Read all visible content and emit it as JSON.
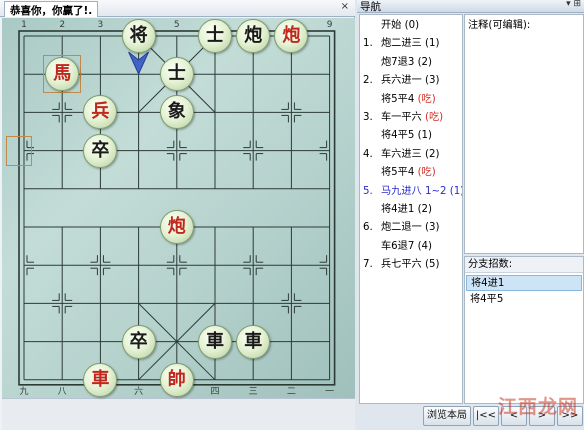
{
  "board_window": {
    "tab_title": "恭喜你，你赢了!.",
    "close_glyph": "×",
    "file_numbers_top": [
      "1",
      "2",
      "3",
      "4",
      "5",
      "6",
      "7",
      "8",
      "9"
    ],
    "file_numbers_bottom": [
      "九",
      "八",
      "七",
      "六",
      "五",
      "四",
      "三",
      "二",
      "一"
    ],
    "pieces": [
      {
        "char": "将",
        "side": "black",
        "file": 3,
        "rank": 0
      },
      {
        "char": "士",
        "side": "black",
        "file": 5,
        "rank": 0
      },
      {
        "char": "炮",
        "side": "black",
        "file": 6,
        "rank": 0
      },
      {
        "char": "炮",
        "side": "red",
        "file": 7,
        "rank": 0
      },
      {
        "char": "馬",
        "side": "red",
        "file": 1,
        "rank": 1,
        "marked": true
      },
      {
        "char": "士",
        "side": "black",
        "file": 4,
        "rank": 1
      },
      {
        "char": "兵",
        "side": "red",
        "file": 2,
        "rank": 2
      },
      {
        "char": "象",
        "side": "black",
        "file": 4,
        "rank": 2
      },
      {
        "char": "卒",
        "side": "black",
        "file": 2,
        "rank": 3
      },
      {
        "char": "炮",
        "side": "red",
        "file": 4,
        "rank": 5
      },
      {
        "char": "卒",
        "side": "black",
        "file": 3,
        "rank": 8
      },
      {
        "char": "車",
        "side": "black",
        "file": 5,
        "rank": 8
      },
      {
        "char": "車",
        "side": "black",
        "file": 6,
        "rank": 8
      },
      {
        "char": "車",
        "side": "red",
        "file": 2,
        "rank": 9
      },
      {
        "char": "帥",
        "side": "red",
        "file": 4,
        "rank": 9
      }
    ],
    "last_move_from": {
      "file": 0,
      "rank": 3
    },
    "arrow_file": 3
  },
  "navigation": {
    "title": "导航",
    "pin_glyph": "▾ ⊞",
    "moves": [
      {
        "num": "",
        "text": "开始 (0)",
        "capture": ""
      },
      {
        "num": "1.",
        "text": "炮二进三 (1)",
        "capture": ""
      },
      {
        "num": "",
        "text": "炮7退3 (2)",
        "capture": ""
      },
      {
        "num": "2.",
        "text": "兵六进一 (3)",
        "capture": ""
      },
      {
        "num": "",
        "text": "将5平4 ",
        "capture": "(吃)"
      },
      {
        "num": "3.",
        "text": "车一平六 ",
        "capture": "(吃)"
      },
      {
        "num": "",
        "text": "将4平5 (1)",
        "capture": ""
      },
      {
        "num": "4.",
        "text": "车六进三 (2)",
        "capture": ""
      },
      {
        "num": "",
        "text": "将5平4 ",
        "capture": "(吃)"
      },
      {
        "num": "5.",
        "text": "马九进八 1~2 (1)",
        "capture": "",
        "current": true
      },
      {
        "num": "",
        "text": "将4进1 (2)",
        "capture": ""
      },
      {
        "num": "6.",
        "text": "炮二退一 (3)",
        "capture": ""
      },
      {
        "num": "",
        "text": "车6退7 (4)",
        "capture": ""
      },
      {
        "num": "7.",
        "text": "兵七平六 (5)",
        "capture": ""
      }
    ],
    "comment_label": "注释(可编辑):",
    "comment_text": "",
    "branch_label": "分支招数:",
    "branches": [
      {
        "text": "将4进1",
        "selected": true
      },
      {
        "text": "将4平5",
        "selected": false
      }
    ],
    "buttons": {
      "browse": "浏览本局",
      "first": "|<<",
      "prev": "<",
      "next": ">",
      "last": ">>"
    }
  },
  "watermark": "江西龙网",
  "colors": {
    "red_piece": "#c0271d",
    "black_piece": "#1a1a1a",
    "board_bg": "#b7d3ce",
    "current_move": "#2a2ad0",
    "capture_text": "#d42b20",
    "selected_branch": "#cde4f7"
  }
}
